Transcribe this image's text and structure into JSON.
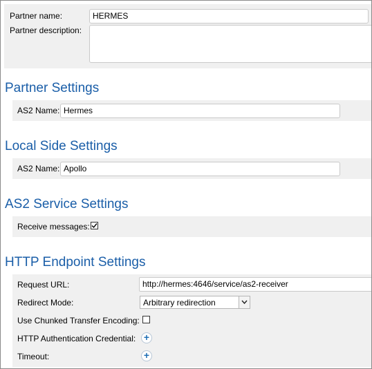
{
  "partner": {
    "name_label": "Partner name:",
    "name_value": "HERMES",
    "description_label": "Partner description:",
    "description_value": ""
  },
  "partner_settings": {
    "heading": "Partner Settings",
    "as2_name_label": "AS2 Name:",
    "as2_name_value": "Hermes"
  },
  "local_side_settings": {
    "heading": "Local Side Settings",
    "as2_name_label": "AS2 Name:",
    "as2_name_value": "Apollo"
  },
  "as2_service_settings": {
    "heading": "AS2 Service Settings",
    "receive_messages_label": "Receive messages:",
    "receive_messages_checked": true
  },
  "http_endpoint_settings": {
    "heading": "HTTP Endpoint Settings",
    "request_url_label": "Request URL:",
    "request_url_value": "http://hermes:4646/service/as2-receiver",
    "redirect_mode_label": "Redirect Mode:",
    "redirect_mode_value": "Arbitrary redirection",
    "chunked_label": "Use Chunked Transfer Encoding:",
    "chunked_checked": false,
    "http_auth_label": "HTTP Authentication Credential:",
    "timeout_label": "Timeout:"
  },
  "icons": {
    "checkmark": "checkmark-icon",
    "add": "plus-circle-icon",
    "dropdown": "chevron-down-icon"
  },
  "colors": {
    "heading": "#1a5ea8",
    "panel": "#f0f0f0",
    "add_icon": "#1f6fb5"
  }
}
